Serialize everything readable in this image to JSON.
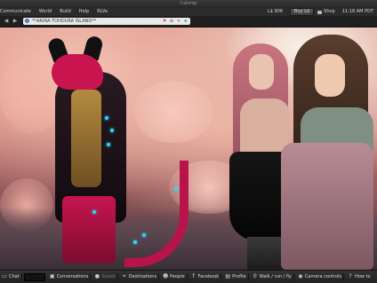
{
  "window": {
    "title": "Catznip"
  },
  "menubar": {
    "items": [
      "Communicate",
      "World",
      "Build",
      "Help",
      "RLVa"
    ],
    "balance": "L$ 906",
    "buy_label": "Buy L$",
    "shop_label": "Shop",
    "time": "11:18 AM PDT"
  },
  "navbar": {
    "back_icon": "back-arrow-icon",
    "forward_icon": "forward-arrow-icon",
    "location_text": "**ARINA TOHDURA ISLAND**"
  },
  "toolbar": {
    "chat_label": "Chat",
    "conversations_label": "Conversations",
    "speak_label": "Speak",
    "destinations_label": "Destinations",
    "people_label": "People",
    "facebook_label": "Facebook",
    "profile_label": "Profile",
    "walk_label": "Walk / run / fly",
    "camera_label": "Camera controls",
    "howto_label": "How to"
  },
  "colors": {
    "accent": "#c8154f",
    "glow": "#2fd6ff"
  }
}
